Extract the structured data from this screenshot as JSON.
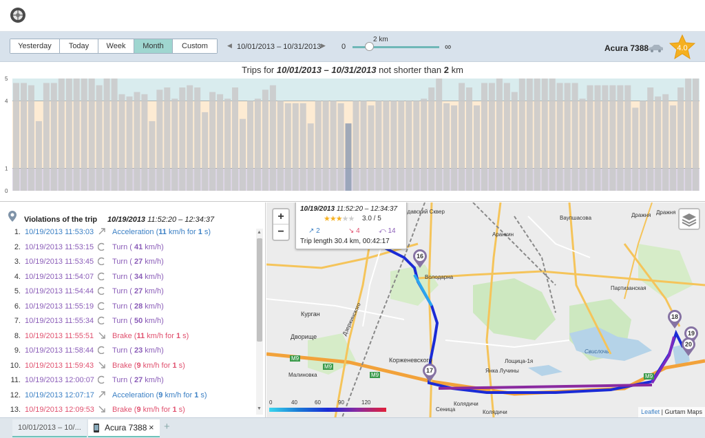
{
  "toolbar": {
    "period_buttons": [
      "Yesterday",
      "Today",
      "Week",
      "Month",
      "Custom"
    ],
    "active_period": "Month",
    "date_range": "10/01/2013 – 10/31/2013",
    "slider": {
      "min_label": "0",
      "value_label": "2 km",
      "max_label": "∞",
      "value_fraction": 0.15
    },
    "unit_name": "Acura 7388",
    "rating": "4.0"
  },
  "chart": {
    "title_prefix": "Trips for ",
    "title_range": "10/01/2013 – 10/31/2013",
    "title_middle": " not shorter than ",
    "title_distance": "2",
    "title_suffix": " km"
  },
  "chart_data": {
    "type": "bar",
    "ylim": [
      0,
      5
    ],
    "y_ticks": [
      "0",
      "1",
      "4",
      "5"
    ],
    "bands": [
      {
        "from": 4,
        "to": 5,
        "color": "#d9ecee"
      },
      {
        "from": 1,
        "to": 4,
        "color": "#fdebd3"
      },
      {
        "from": 0,
        "to": 1,
        "color": "#ddd6e6"
      }
    ],
    "values": [
      4.8,
      4.8,
      4.7,
      3.1,
      4.8,
      4.8,
      5.0,
      5.0,
      5.0,
      5.0,
      5.0,
      4.7,
      5.0,
      5.0,
      4.3,
      4.2,
      4.4,
      4.3,
      3.1,
      4.5,
      4.6,
      4.1,
      4.6,
      4.7,
      4.6,
      3.5,
      4.4,
      4.3,
      4.1,
      4.6,
      3.2,
      4.0,
      4.1,
      4.5,
      4.7,
      4.0,
      3.9,
      3.9,
      3.9,
      3.0,
      4.0,
      4.0,
      4.0,
      3.9,
      3.0,
      4.0,
      4.0,
      3.8,
      4.0,
      4.0,
      4.0,
      4.0,
      4.0,
      4.0,
      4.1,
      4.6,
      5.0,
      3.9,
      3.8,
      4.8,
      4.6,
      3.8,
      4.8,
      4.8,
      5.0,
      4.8,
      4.4,
      5.0,
      5.0,
      5.0,
      5.0,
      5.0,
      4.8,
      4.8,
      4.8,
      4.1,
      4.7,
      4.7,
      4.7,
      4.7,
      4.7,
      4.7,
      3.7,
      4.0,
      4.6,
      4.2,
      4.3,
      3.8,
      4.6,
      5.0,
      5.0
    ],
    "highlighted_index": 44,
    "bar_color": "#c9c9c9",
    "highlight_color": "#8f9eb3"
  },
  "violations": {
    "title": "Violations of the trip",
    "trip_date": "10/19/2013",
    "trip_time": " 11:52:20 – 12:34:37",
    "items": [
      {
        "num": "1.",
        "time": "10/19/2013 11:53:03",
        "type": "Acceleration",
        "pre": "Acceleration (",
        "val1": "11",
        "mid": " km/h for ",
        "val2": "1",
        "post": " s)"
      },
      {
        "num": "2.",
        "time": "10/19/2013 11:53:15",
        "type": "Turn",
        "pre": "Turn ( ",
        "val1": "41",
        "mid": " km/h)",
        "val2": "",
        "post": ""
      },
      {
        "num": "3.",
        "time": "10/19/2013 11:53:45",
        "type": "Turn",
        "pre": "Turn ( ",
        "val1": "27",
        "mid": " km/h)",
        "val2": "",
        "post": ""
      },
      {
        "num": "4.",
        "time": "10/19/2013 11:54:07",
        "type": "Turn",
        "pre": "Turn ( ",
        "val1": "34",
        "mid": " km/h)",
        "val2": "",
        "post": ""
      },
      {
        "num": "5.",
        "time": "10/19/2013 11:54:44",
        "type": "Turn",
        "pre": "Turn ( ",
        "val1": "27",
        "mid": " km/h)",
        "val2": "",
        "post": ""
      },
      {
        "num": "6.",
        "time": "10/19/2013 11:55:19",
        "type": "Turn",
        "pre": "Turn ( ",
        "val1": "28",
        "mid": " km/h)",
        "val2": "",
        "post": ""
      },
      {
        "num": "7.",
        "time": "10/19/2013 11:55:34",
        "type": "Turn",
        "pre": "Turn ( ",
        "val1": "50",
        "mid": " km/h)",
        "val2": "",
        "post": ""
      },
      {
        "num": "8.",
        "time": "10/19/2013 11:55:51",
        "type": "Brake",
        "pre": "Brake (",
        "val1": "11",
        "mid": " km/h for ",
        "val2": "1",
        "post": " s)"
      },
      {
        "num": "9.",
        "time": "10/19/2013 11:58:44",
        "type": "Turn",
        "pre": "Turn ( ",
        "val1": "23",
        "mid": " km/h)",
        "val2": "",
        "post": ""
      },
      {
        "num": "10.",
        "time": "10/19/2013 11:59:43",
        "type": "Brake",
        "pre": "Brake (",
        "val1": "9",
        "mid": " km/h for ",
        "val2": "1",
        "post": " s)"
      },
      {
        "num": "11.",
        "time": "10/19/2013 12:00:07",
        "type": "Turn",
        "pre": "Turn ( ",
        "val1": "27",
        "mid": " km/h)",
        "val2": "",
        "post": ""
      },
      {
        "num": "12.",
        "time": "10/19/2013 12:07:17",
        "type": "Acceleration",
        "pre": "Acceleration (",
        "val1": "9",
        "mid": " km/h for ",
        "val2": "1",
        "post": " s)"
      },
      {
        "num": "13.",
        "time": "10/19/2013 12:09:53",
        "type": "Brake",
        "pre": "Brake (",
        "val1": "9",
        "mid": " km/h for ",
        "val2": "1",
        "post": " s)"
      }
    ]
  },
  "colors": {
    "Acceleration": "#3a7fc4",
    "Turn": "#8a5cb8",
    "Brake": "#e0506e"
  },
  "map": {
    "popup": {
      "date": "10/19/2013",
      "time": " 11:52:20 – 12:34:37",
      "rating": "3.0 / 5",
      "stars_filled": 3,
      "acc": "2",
      "brake": "4",
      "turn": "14",
      "length": "Trip length 30.4 km, 00:42:17"
    },
    "markers": [
      "16",
      "17",
      "18",
      "19",
      "20"
    ],
    "labels": [
      "Сендавский Сквер",
      "Аранкин",
      "Володарна",
      "Дзержинского",
      "Курган",
      "Дворище",
      "Малиновка",
      "Корженевского",
      "Лощица-1я",
      "Янка Лучины",
      "Колядичи",
      "Колядичи",
      "Сеница",
      "Свислочь",
      "Дражня",
      "Дражня",
      "Ваупшасова",
      "Партизанская",
      "M9",
      "M9",
      "M9",
      "M9"
    ],
    "speed_scale": [
      "0",
      "40",
      "60",
      "90",
      "120"
    ],
    "attribution_link": "Leaflet",
    "attribution_text": " | Gurtam Maps"
  },
  "tabs": {
    "tab1": "10/01/2013 – 10/...",
    "tab2": "Acura 7388",
    "close": "×",
    "add": "+"
  }
}
